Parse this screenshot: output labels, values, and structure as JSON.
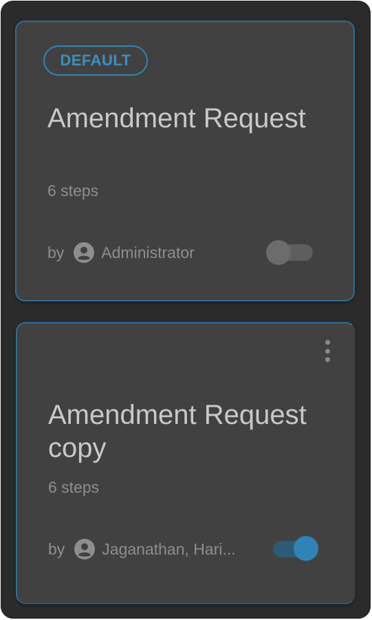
{
  "cards": [
    {
      "badge": "DEFAULT",
      "title": "Amendment Request",
      "steps": "6 steps",
      "by_label": "by",
      "owner": "Administrator",
      "owner_icon": "account-circle-icon",
      "enabled": false
    },
    {
      "title": "Amendment Request copy",
      "steps": "6 steps",
      "by_label": "by",
      "owner": "Jaganathan, Hari...",
      "owner_icon": "account-circle-icon",
      "enabled": true,
      "menu_icon": "more-vertical-icon"
    }
  ],
  "colors": {
    "accent": "#2f84b5",
    "card_bg": "#414141",
    "panel_bg": "#2b2b2b"
  }
}
